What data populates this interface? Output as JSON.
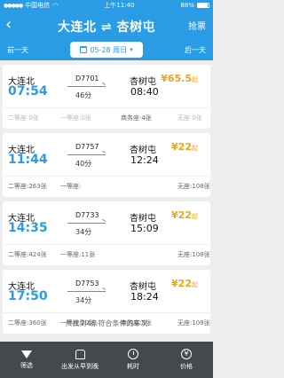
{
  "status": {
    "carrier": "中国电信",
    "time": "上午11:40",
    "battery": "88%"
  },
  "header": {
    "title": "大连北 ⇌ 杏树屯",
    "grab_label": "抢票"
  },
  "datebar": {
    "prev_label": "前一天",
    "date": "05-28 周日",
    "next_label": "后一天"
  },
  "trains": [
    {
      "from": "大连北",
      "depart": "07:54",
      "number": "D7701",
      "duration": "46分",
      "to": "杏树屯",
      "arrive": "08:40",
      "price": "¥65.5",
      "price_unit": "起",
      "seats": [
        "二等座:0张",
        "一等座:0张",
        "商务座:4张",
        "无座:0张"
      ]
    },
    {
      "from": "大连北",
      "depart": "11:44",
      "number": "D7757",
      "duration": "40分",
      "to": "杏树屯",
      "arrive": "12:24",
      "price": "¥22",
      "price_unit": "起",
      "seats": [
        "二等座:263张",
        "一等座:",
        "",
        "无座:108张"
      ]
    },
    {
      "from": "大连北",
      "depart": "14:35",
      "number": "D7733",
      "duration": "34分",
      "to": "杏树屯",
      "arrive": "15:09",
      "price": "¥22",
      "price_unit": "起",
      "seats": [
        "二等座:424张",
        "一等座:11张",
        "",
        "无座:108张"
      ]
    },
    {
      "from": "大连北",
      "depart": "17:50",
      "number": "D7753",
      "duration": "34分",
      "to": "杏树屯",
      "arrive": "18:24",
      "price": "¥22",
      "price_unit": "起",
      "seats": [
        "二等座:360张",
        "一等座:20张",
        "商务座:5张",
        "无座:108张"
      ]
    }
  ],
  "summary": "共找到4条符合条件的车次",
  "tabs": [
    {
      "label": "筛选",
      "icon": "filter-icon"
    },
    {
      "label": "出发从早到晚",
      "icon": "train-icon"
    },
    {
      "label": "耗时",
      "icon": "clock-icon"
    },
    {
      "label": "价格",
      "icon": "price-icon"
    }
  ],
  "colors": {
    "primary": "#2a9ce6",
    "price": "#f0a21b",
    "bottombar": "#45484d"
  }
}
